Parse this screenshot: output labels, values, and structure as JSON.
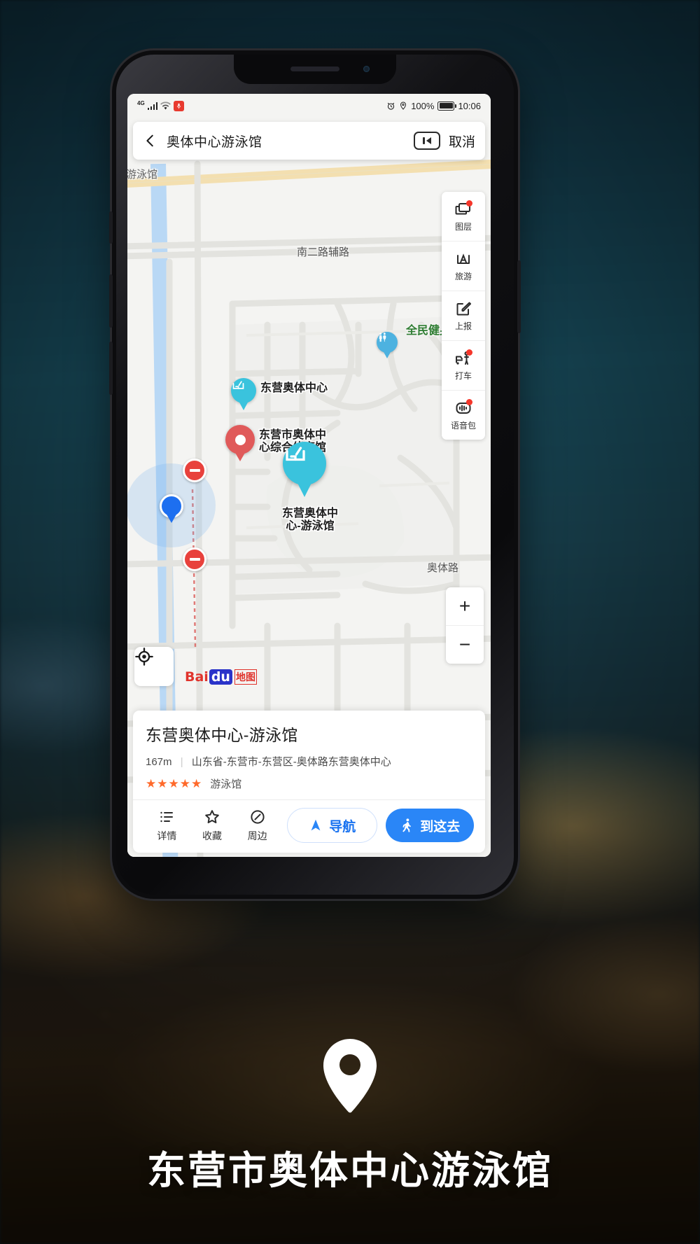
{
  "statusbar": {
    "network": "4G",
    "battery_percent": "100%",
    "time": "10:06",
    "icons": [
      "signal-bars-icon",
      "wifi-icon",
      "mic-recording-icon",
      "alarm-clock-icon",
      "location-pin-icon",
      "battery-icon"
    ]
  },
  "search": {
    "back_icon": "back-chevron-icon",
    "query": "奥体中心游泳馆",
    "voice_icon": "voice-search-icon",
    "cancel_label": "取消"
  },
  "toolbar": {
    "items": [
      {
        "label": "图层",
        "icon": "layers-icon",
        "badge": true
      },
      {
        "label": "旅游",
        "icon": "tourism-icon",
        "badge": false
      },
      {
        "label": "上报",
        "icon": "report-edit-icon",
        "badge": false
      },
      {
        "label": "打车",
        "icon": "taxi-icon",
        "badge": true
      },
      {
        "label": "语音包",
        "icon": "voice-pack-icon",
        "badge": true
      }
    ]
  },
  "map": {
    "provider": {
      "bai": "Bai",
      "du": "du",
      "suffix": "地图"
    },
    "locate_icon": "locate-crosshair-icon",
    "zoom_in": "+",
    "zoom_out": "−",
    "road_labels": [
      {
        "text": "南二路辅路"
      },
      {
        "text": "奥体路"
      },
      {
        "text": "游泳馆"
      }
    ],
    "pois": [
      {
        "label": "东营奥体中心",
        "icon": "sports-venue-icon",
        "color": "#3ac3dd"
      },
      {
        "label": "东营市奥体中\n心综合体育馆",
        "icon": "red-marker-icon",
        "color": "#e05a5a"
      },
      {
        "label": "东营奥体中\n心-游泳馆",
        "icon": "sports-venue-icon",
        "color": "#3ac3dd"
      },
      {
        "label": "全民健身公",
        "icon": "park-icon",
        "color": "#4cb84c"
      },
      {
        "label": "",
        "icon": "restroom-icon",
        "color": "#4db2e0"
      }
    ]
  },
  "card": {
    "title": "东营奥体中心-游泳馆",
    "distance": "167m",
    "address": "山东省-东营市-东营区-奥体路东营奥体中心",
    "stars": "★★★★★",
    "category": "游泳馆",
    "actions": [
      {
        "label": "详情",
        "icon": "list-detail-icon"
      },
      {
        "label": "收藏",
        "icon": "star-favorite-icon"
      },
      {
        "label": "周边",
        "icon": "compass-nearby-icon"
      }
    ],
    "nav_label": "导航",
    "nav_icon": "navigation-arrow-icon",
    "go_label": "到这去",
    "go_icon": "walking-person-icon"
  },
  "footer": {
    "pin_icon": "location-pin-icon",
    "title": "东营市奥体中心游泳馆"
  },
  "colors": {
    "accent_blue": "#2a86f7",
    "star_orange": "#ff6a2b",
    "badge_red": "#f5362a",
    "venue_cyan": "#3ac3dd"
  }
}
